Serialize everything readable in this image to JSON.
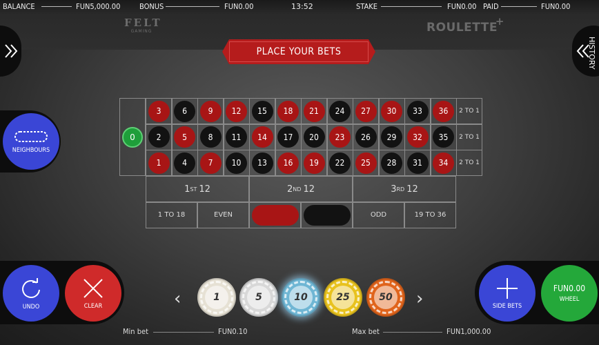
{
  "header": {
    "balance_label": "BALANCE",
    "balance_value": "FUN5,000.00",
    "bonus_label": "BONUS",
    "bonus_value": "FUN0.00",
    "clock": "13:52",
    "stake_label": "STAKE",
    "stake_value": "FUN0.00",
    "paid_label": "PAID",
    "paid_value": "FUN0.00"
  },
  "logos": {
    "felt_text": "FELT",
    "felt_sub": "GAMING",
    "roulette_text": "ROULETTE",
    "roulette_plus": "+"
  },
  "side_tabs": {
    "history_label": "HISTORY"
  },
  "banner": {
    "text": "PLACE YOUR BETS"
  },
  "table": {
    "zero": "0",
    "rows": [
      [
        {
          "n": "3",
          "c": "red"
        },
        {
          "n": "6",
          "c": "black"
        },
        {
          "n": "9",
          "c": "red"
        },
        {
          "n": "12",
          "c": "red"
        },
        {
          "n": "15",
          "c": "black"
        },
        {
          "n": "18",
          "c": "red"
        },
        {
          "n": "21",
          "c": "red"
        },
        {
          "n": "24",
          "c": "black"
        },
        {
          "n": "27",
          "c": "red"
        },
        {
          "n": "30",
          "c": "red"
        },
        {
          "n": "33",
          "c": "black"
        },
        {
          "n": "36",
          "c": "red"
        }
      ],
      [
        {
          "n": "2",
          "c": "black"
        },
        {
          "n": "5",
          "c": "red"
        },
        {
          "n": "8",
          "c": "black"
        },
        {
          "n": "11",
          "c": "black"
        },
        {
          "n": "14",
          "c": "red"
        },
        {
          "n": "17",
          "c": "black"
        },
        {
          "n": "20",
          "c": "black"
        },
        {
          "n": "23",
          "c": "red"
        },
        {
          "n": "26",
          "c": "black"
        },
        {
          "n": "29",
          "c": "black"
        },
        {
          "n": "32",
          "c": "red"
        },
        {
          "n": "35",
          "c": "black"
        }
      ],
      [
        {
          "n": "1",
          "c": "red"
        },
        {
          "n": "4",
          "c": "black"
        },
        {
          "n": "7",
          "c": "red"
        },
        {
          "n": "10",
          "c": "black"
        },
        {
          "n": "13",
          "c": "black"
        },
        {
          "n": "16",
          "c": "red"
        },
        {
          "n": "19",
          "c": "red"
        },
        {
          "n": "22",
          "c": "black"
        },
        {
          "n": "25",
          "c": "red"
        },
        {
          "n": "28",
          "c": "black"
        },
        {
          "n": "31",
          "c": "black"
        },
        {
          "n": "34",
          "c": "red"
        }
      ]
    ],
    "column_bets": [
      "2 TO 1",
      "2 TO 1",
      "2 TO 1"
    ],
    "dozens": [
      {
        "num": "1",
        "sup": "ST",
        "rest": "12"
      },
      {
        "num": "2",
        "sup": "ND",
        "rest": "12"
      },
      {
        "num": "3",
        "sup": "RD",
        "rest": "12"
      }
    ],
    "outside": {
      "low": "1 TO 18",
      "even": "EVEN",
      "odd": "ODD",
      "high": "19 TO 36"
    }
  },
  "buttons": {
    "neighbours": "NEIGHBOURS",
    "undo": "UNDO",
    "clear": "CLEAR",
    "side_bets": "SIDE BETS",
    "wheel_amount": "FUN0.00",
    "wheel": "WHEEL"
  },
  "chips": [
    {
      "value": "1",
      "color": "#e6e1d4"
    },
    {
      "value": "5",
      "color": "#d8d8d8"
    },
    {
      "value": "10",
      "color": "#6fb6d4"
    },
    {
      "value": "25",
      "color": "#e8c21e"
    },
    {
      "value": "50",
      "color": "#e0641c"
    }
  ],
  "limits": {
    "min_label": "Min bet",
    "min_value": "FUN0.10",
    "max_label": "Max bet",
    "max_value": "FUN1,000.00"
  },
  "colors": {
    "red": "#a81515",
    "black": "#121212",
    "green": "#1e9e3a",
    "blue_button": "#3a46d6",
    "red_button": "#cf2a2a",
    "green_button": "#24a83a"
  }
}
